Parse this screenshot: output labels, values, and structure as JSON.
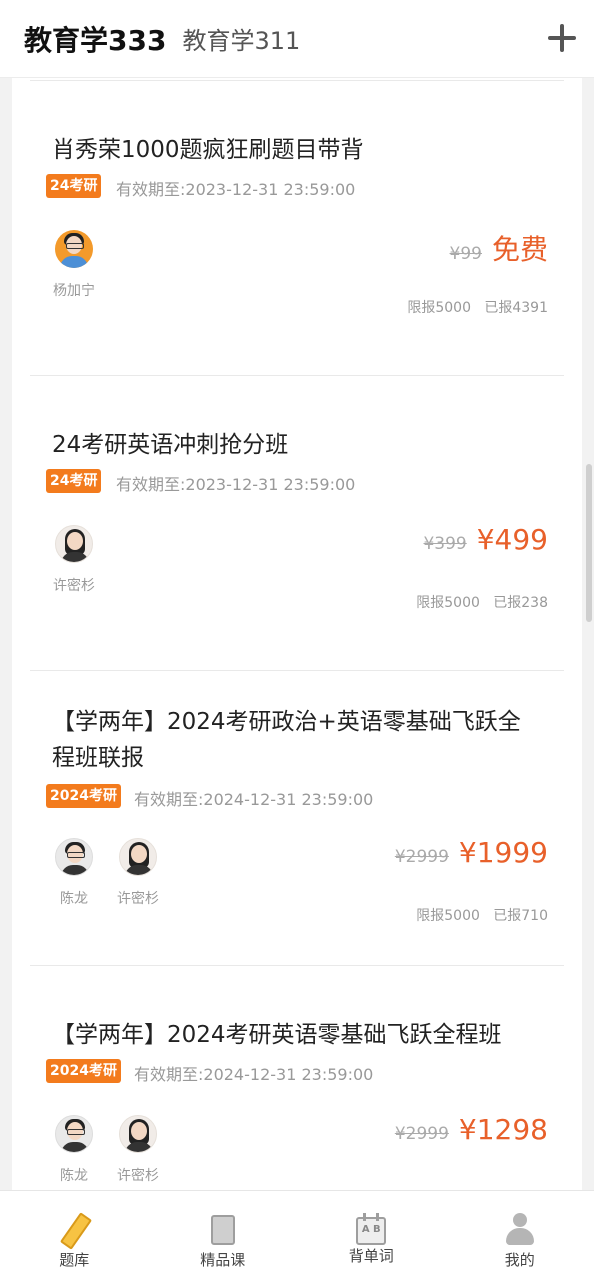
{
  "header": {
    "active_tab": "教育学333",
    "inactive_tab": "教育学311"
  },
  "courses": [
    {
      "title": "肖秀荣1000题疯狂刷题目带背",
      "tag": "24考研",
      "validity": "有效期至:2023-12-31 23:59:00",
      "teachers": [
        "杨加宁"
      ],
      "original_price": "¥99",
      "price": "免费",
      "quota": "限报5000",
      "enrolled": "已报4391"
    },
    {
      "title": "24考研英语冲刺抢分班",
      "tag": "24考研",
      "validity": "有效期至:2023-12-31 23:59:00",
      "teachers": [
        "许密杉"
      ],
      "original_price": "¥399",
      "price": "¥499",
      "quota": "限报5000",
      "enrolled": "已报238"
    },
    {
      "title": "【学两年】2024考研政治+英语零基础飞跃全程班联报",
      "tag": "2024考研",
      "validity": "有效期至:2024-12-31 23:59:00",
      "teachers": [
        "陈龙",
        "许密杉"
      ],
      "original_price": "¥2999",
      "price": "¥1999",
      "quota": "限报5000",
      "enrolled": "已报710"
    },
    {
      "title": "【学两年】2024考研英语零基础飞跃全程班",
      "tag": "2024考研",
      "validity": "有效期至:2024-12-31 23:59:00",
      "teachers": [
        "陈龙",
        "许密杉"
      ],
      "original_price": "¥2999",
      "price": "¥1298"
    }
  ],
  "bottom_nav": [
    {
      "label": "题库",
      "icon": "pencil-icon"
    },
    {
      "label": "精品课",
      "icon": "book-icon"
    },
    {
      "label": "背单词",
      "icon": "calendar-icon",
      "icon_text": "A B"
    },
    {
      "label": "我的",
      "icon": "person-icon"
    }
  ],
  "colors": {
    "accent": "#f37b1d",
    "price": "#e8602a"
  }
}
